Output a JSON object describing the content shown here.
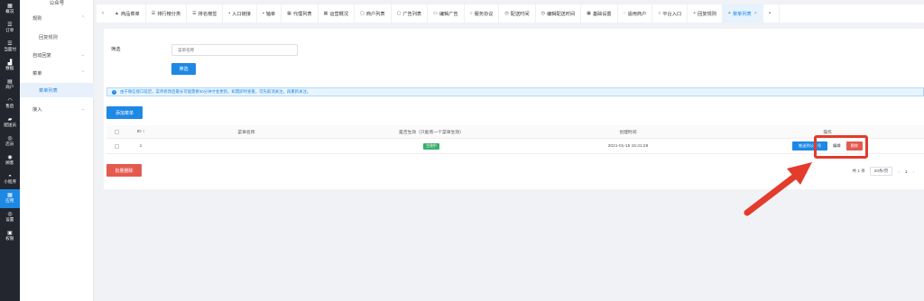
{
  "rail": [
    {
      "icon": "grid-icon",
      "glyph": "▦",
      "label": "概况"
    },
    {
      "icon": "list-icon",
      "glyph": "☰",
      "label": "订单"
    },
    {
      "icon": "list-icon",
      "glyph": "☰",
      "label": "当面付"
    },
    {
      "icon": "chart-icon",
      "glyph": "▟",
      "label": "数据"
    },
    {
      "icon": "store-icon",
      "glyph": "▤",
      "label": "商户"
    },
    {
      "icon": "headset-icon",
      "glyph": "◠",
      "label": "售后"
    },
    {
      "icon": "truck-icon",
      "glyph": "▰",
      "label": "配送员"
    },
    {
      "icon": "user-icon",
      "glyph": "◎",
      "label": "店员"
    },
    {
      "icon": "user-circle-icon",
      "glyph": "◉",
      "label": "顾客"
    },
    {
      "icon": "wechat-icon",
      "glyph": "◓",
      "label": "小程序"
    },
    {
      "icon": "apps-icon",
      "glyph": "▦",
      "label": "应用"
    },
    {
      "icon": "settings-icon",
      "glyph": "◎",
      "label": "设置"
    },
    {
      "icon": "lock-icon",
      "glyph": "▣",
      "label": "权限"
    }
  ],
  "sub": {
    "title": "公众号",
    "items": [
      {
        "type": "group",
        "label": "规则"
      },
      {
        "type": "leaf",
        "label": "回复规则"
      },
      {
        "type": "group",
        "label": "自动回复"
      },
      {
        "type": "group",
        "label": "菜单"
      },
      {
        "type": "leaf",
        "label": "菜单列表"
      },
      {
        "type": "group",
        "label": "接入"
      }
    ]
  },
  "tabs": [
    {
      "icon": "shop-icon",
      "glyph": "▲",
      "label": "商品菜单"
    },
    {
      "icon": "list-icon",
      "glyph": "☰",
      "label": "排行榜分类"
    },
    {
      "icon": "list-icon",
      "glyph": "☰",
      "label": "排名榜签"
    },
    {
      "icon": "box-icon",
      "glyph": "▪",
      "label": "入口链接"
    },
    {
      "icon": "box-icon",
      "glyph": "▪",
      "label": "轴单"
    },
    {
      "icon": "grid-icon",
      "glyph": "▦",
      "label": "代理列表"
    },
    {
      "icon": "grid-icon",
      "glyph": "▦",
      "label": "运营概况"
    },
    {
      "icon": "doc-icon",
      "glyph": "▢",
      "label": "商户列表"
    },
    {
      "icon": "doc-icon",
      "glyph": "▢",
      "label": "广告列表"
    },
    {
      "icon": "image-icon",
      "glyph": "▭",
      "label": "编辑广告"
    },
    {
      "icon": "search-icon",
      "glyph": "○",
      "label": "服务协议"
    },
    {
      "icon": "clock-icon",
      "glyph": "◷",
      "label": "配送时间"
    },
    {
      "icon": "clock-icon",
      "glyph": "◷",
      "label": "编辑配送时间"
    },
    {
      "icon": "check-icon",
      "glyph": "▣",
      "label": "基础设置"
    },
    {
      "icon": "refresh-icon",
      "glyph": "◌",
      "label": "适用商户"
    },
    {
      "icon": "search-icon",
      "glyph": "○",
      "label": "平台入口"
    },
    {
      "icon": "wechat-icon",
      "glyph": "◓",
      "label": "回复规则"
    },
    {
      "icon": "wechat-icon",
      "glyph": "◓",
      "label": "菜单列表",
      "active": true,
      "close": "×"
    },
    {
      "icon": "wechat-icon",
      "glyph": "◓",
      "label": ""
    }
  ],
  "tab_left": "‹",
  "filter": {
    "label": "筛选",
    "placeholder": "菜单名称",
    "button": "筛选"
  },
  "notice": {
    "icon": "info-icon",
    "glyph": "i",
    "text": "由于微信接口延迟，菜单修改后最长可能需要30分钟才会更新。如需即时查看，可先取消关注，再重新关注。"
  },
  "add_button": "添加菜单",
  "table": {
    "headers": {
      "id": "ID ↕",
      "name": "菜单名称",
      "effective": "是否生效（只能有一个菜单生效）",
      "created": "创建时间",
      "ops": "操作"
    },
    "rows": [
      {
        "id": "1",
        "name": "",
        "effective": "生效中",
        "created": "2021-01-15 15:41:28",
        "set_button": "推送到公众号",
        "edit": "编辑",
        "delete": "删除"
      }
    ]
  },
  "bulk_delete": "批量删除",
  "pager": {
    "total": "共 1 条",
    "size": "20条/页",
    "prev": "‹",
    "page": "1",
    "next": "›"
  },
  "colors": {
    "accent": "#1e88e5",
    "danger": "#e55a4e",
    "success": "#3bb06a",
    "annotation": "#e33b2c",
    "rail": "#23262e"
  }
}
